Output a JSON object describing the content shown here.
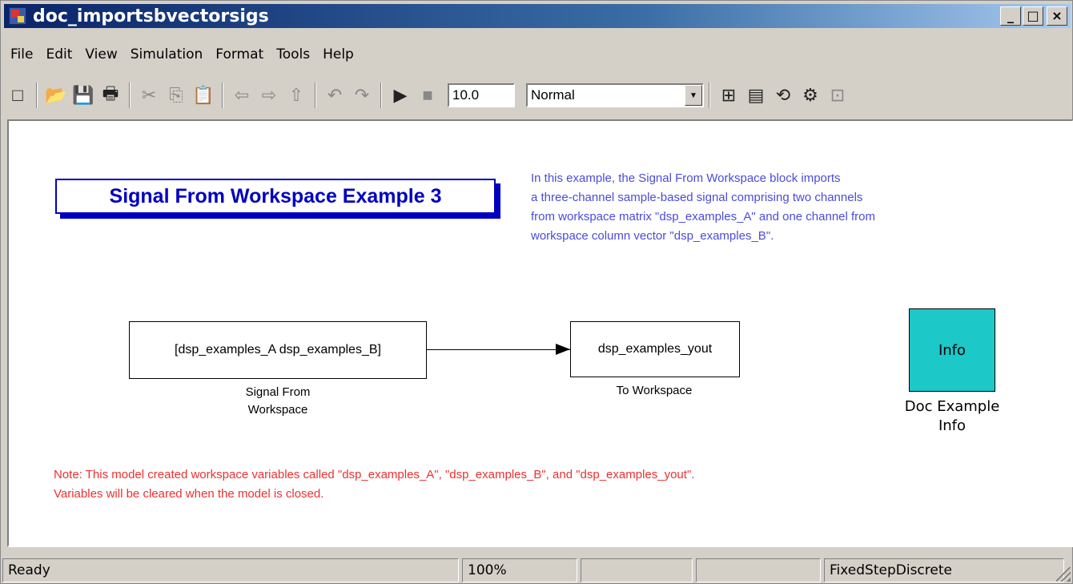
{
  "window": {
    "title": "doc_importsbvectorsigs",
    "controls": [
      "_",
      "□",
      "×"
    ]
  },
  "menu": [
    "File",
    "Edit",
    "View",
    "Simulation",
    "Format",
    "Tools",
    "Help"
  ],
  "toolbar": {
    "stop_time": "10.0",
    "sim_mode": "Normal",
    "icons": {
      "new": "□",
      "open": "📂",
      "save": "💾",
      "print": "🖶",
      "cut": "✂",
      "copy": "⎘",
      "paste": "📋",
      "back": "⇦",
      "forward": "⇨",
      "up": "⇧",
      "undo": "↶",
      "redo": "↷",
      "start": "▶",
      "stop": "■",
      "model_browser": "⊞",
      "library": "▤",
      "update": "⟲",
      "build": "⚙",
      "debug": "⊡"
    }
  },
  "canvas": {
    "model_title": "Signal From Workspace Example 3",
    "description": [
      "In this example, the Signal From Workspace block imports",
      "a three-channel sample-based signal comprising two channels",
      "from workspace matrix \"dsp_examples_A\" and one channel from",
      "workspace column vector \"dsp_examples_B\"."
    ],
    "source_block": {
      "text": "[dsp_examples_A dsp_examples_B]",
      "label_line1": "Signal From",
      "label_line2": "Workspace"
    },
    "sink_block": {
      "text": "dsp_examples_yout",
      "label": "To Workspace"
    },
    "info_block": {
      "text": "Info",
      "label_line1": "Doc Example",
      "label_line2": "Info",
      "color": "#1cc8c8"
    },
    "note": [
      "Note: This model created workspace variables called \"dsp_examples_A\", \"dsp_examples_B\", and \"dsp_examples_yout\".",
      "Variables will be cleared when the model is closed."
    ]
  },
  "status": {
    "state": "Ready",
    "zoom": "100%",
    "cell3": "",
    "cell4": "",
    "solver": "FixedStepDiscrete"
  },
  "colors": {
    "title_blue": "#0000c0",
    "desc_blue": "#4b4bdc",
    "note_red": "#ee3030"
  }
}
